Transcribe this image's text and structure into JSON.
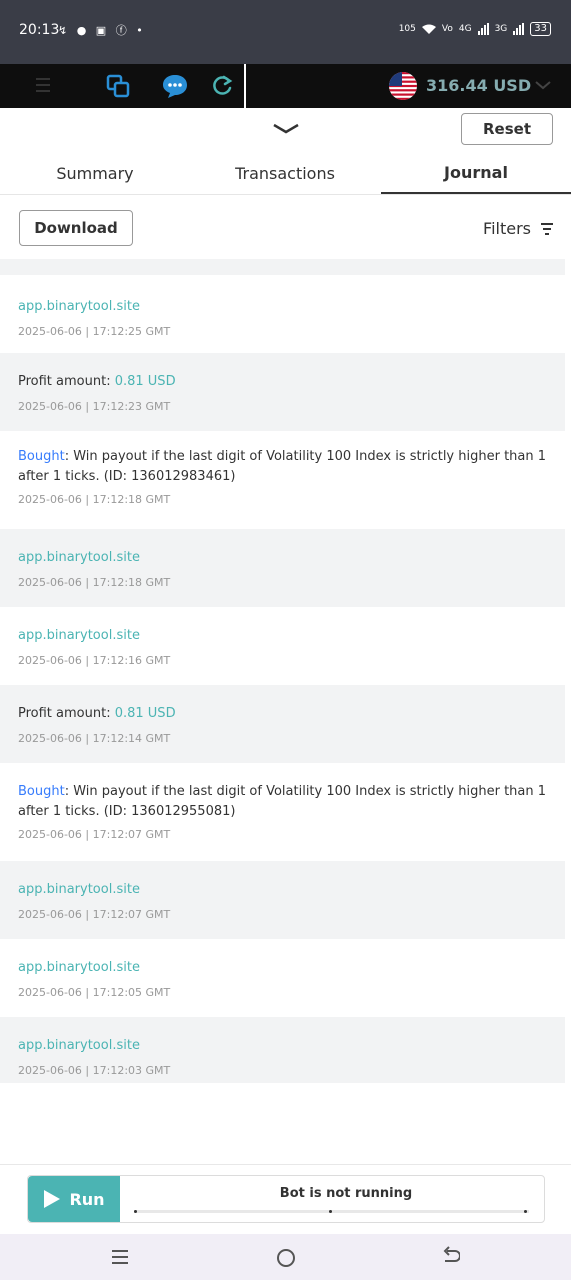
{
  "status_bar": {
    "time": "20:13",
    "notifications": "↯ ● ▣ ⓕ •",
    "speed": "105",
    "net1": "Vo",
    "net2": "4G",
    "net3": "3G",
    "battery": "33"
  },
  "header": {
    "balance": "316.44 USD",
    "icons": [
      "hamburger-icon",
      "copy-icon",
      "chat-icon",
      "refresh-icon",
      "us-flag-icon",
      "chevron-down-icon"
    ]
  },
  "toolbar_top": {
    "reset_label": "Reset"
  },
  "tabs": [
    {
      "label": "Summary"
    },
    {
      "label": "Transactions"
    },
    {
      "label": "Journal",
      "active": true
    }
  ],
  "journal_toolbar": {
    "download_label": "Download",
    "filters_label": "Filters"
  },
  "journal": {
    "entries": [
      {
        "type": "link",
        "link": "app.binarytool.site",
        "time": "2025-06-06 | 17:12:25 GMT"
      },
      {
        "type": "profit",
        "prefix": "Profit amount: ",
        "amount": "0.81 USD",
        "time": "2025-06-06 | 17:12:23 GMT"
      },
      {
        "type": "bought",
        "bought_word": "Bought",
        "line1": ": Win payout if the last digit of Volatility 100 Index is strictly higher than 1",
        "line2": "after 1 ticks. (ID: 136012983461)",
        "time": "2025-06-06 | 17:12:18 GMT"
      },
      {
        "type": "link",
        "link": "app.binarytool.site",
        "time": "2025-06-06 | 17:12:18 GMT"
      },
      {
        "type": "link",
        "link": "app.binarytool.site",
        "time": "2025-06-06 | 17:12:16 GMT"
      },
      {
        "type": "profit",
        "prefix": "Profit amount: ",
        "amount": "0.81 USD",
        "time": "2025-06-06 | 17:12:14 GMT"
      },
      {
        "type": "bought",
        "bought_word": "Bought",
        "line1": ": Win payout if the last digit of Volatility 100 Index is strictly higher than 1",
        "line2": "after 1 ticks. (ID: 136012955081)",
        "time": "2025-06-06 | 17:12:07 GMT"
      },
      {
        "type": "link",
        "link": "app.binarytool.site",
        "time": "2025-06-06 | 17:12:07 GMT"
      },
      {
        "type": "link",
        "link": "app.binarytool.site",
        "time": "2025-06-06 | 17:12:05 GMT"
      },
      {
        "type": "link",
        "link": "app.binarytool.site",
        "time": "2025-06-06 | 17:12:03 GMT"
      }
    ]
  },
  "run_panel": {
    "run_label": "Run",
    "status": "Bot is not running"
  },
  "colors": {
    "accent": "#4bb4b3",
    "bought": "#377cfc",
    "header_bg": "#0e0e0e"
  }
}
